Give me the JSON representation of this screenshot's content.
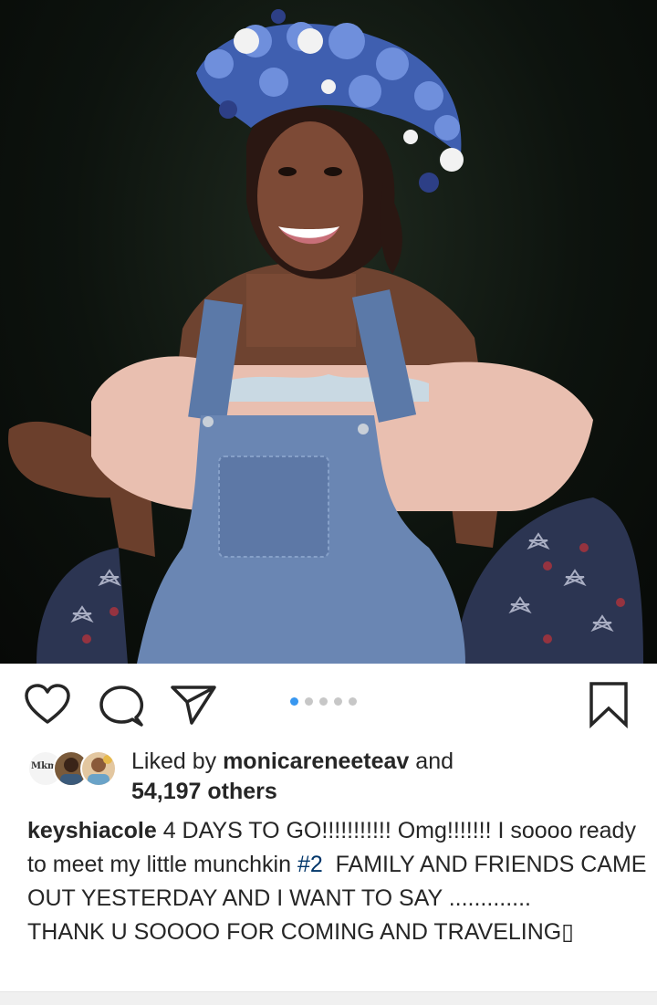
{
  "post": {
    "image_alt": "Woman wearing a blue and white flower crown, denim overalls and a pink off-shoulder top, seated and smiling at night",
    "carousel": {
      "count": 5,
      "active_index": 0
    }
  },
  "actions": {
    "like_icon": "heart-icon",
    "comment_icon": "comment-icon",
    "share_icon": "paper-plane-icon",
    "save_icon": "bookmark-icon"
  },
  "likes": {
    "prefix": "Liked by ",
    "user": "monicareneeteav",
    "conjunction": " and",
    "others": "54,197 others"
  },
  "caption": {
    "username": "keyshiacole",
    "text_part1": " 4 DAYS TO GO!!!!!!!!!!! Omg!!!!!!! I soooo ready to meet my little munchkin ",
    "hashtag": "#2",
    "text_part2": "  FAMILY AND FRIENDS CAME OUT YESTERDAY AND I WANT TO SAY .............\nTHANK U SOOOO FOR COMING AND TRAVELING▯"
  },
  "colors": {
    "accent": "#3897f0",
    "text": "#262626",
    "hashtag": "#003569"
  }
}
